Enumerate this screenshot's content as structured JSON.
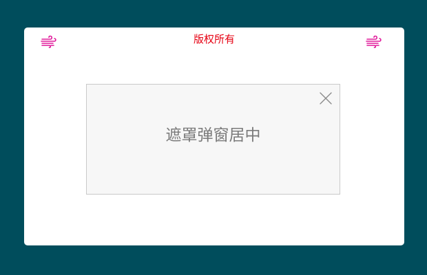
{
  "card": {
    "copyright": "版权所有",
    "left_icon": "wind-icon",
    "right_icon": "wind-icon"
  },
  "modal": {
    "message": "遮罩弹窗居中",
    "close_icon": "close-icon"
  },
  "colors": {
    "page_background": "#004d5c",
    "copyright_text": "#e60012",
    "wind_icon": "#e0189a",
    "modal_background": "#f7f7f7",
    "modal_border": "#c9c9c9",
    "modal_text": "#7a7a7a"
  }
}
